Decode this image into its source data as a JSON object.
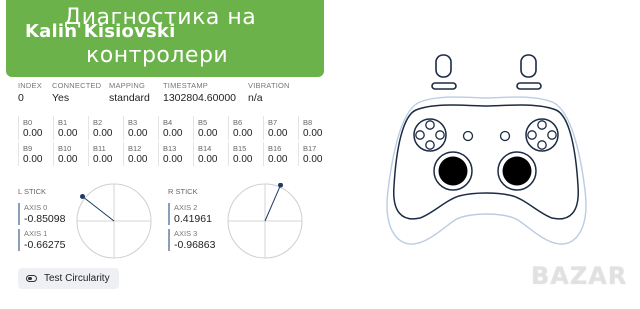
{
  "banner": {
    "author": "Kalin Kisiovski",
    "title_line1": "Диагностика на",
    "title_line2": "контролери"
  },
  "info": [
    {
      "label": "INDEX",
      "value": "0"
    },
    {
      "label": "CONNECTED",
      "value": "Yes"
    },
    {
      "label": "MAPPING",
      "value": "standard"
    },
    {
      "label": "TIMESTAMP",
      "value": "1302804.60000"
    },
    {
      "label": "VIBRATION",
      "value": "n/a"
    }
  ],
  "buttons": [
    {
      "name": "B0",
      "value": "0.00"
    },
    {
      "name": "B1",
      "value": "0.00"
    },
    {
      "name": "B2",
      "value": "0.00"
    },
    {
      "name": "B3",
      "value": "0.00"
    },
    {
      "name": "B4",
      "value": "0.00"
    },
    {
      "name": "B5",
      "value": "0.00"
    },
    {
      "name": "B6",
      "value": "0.00"
    },
    {
      "name": "B7",
      "value": "0.00"
    },
    {
      "name": "B8",
      "value": "0.00"
    },
    {
      "name": "B9",
      "value": "0.00"
    },
    {
      "name": "B10",
      "value": "0.00"
    },
    {
      "name": "B11",
      "value": "0.00"
    },
    {
      "name": "B12",
      "value": "0.00"
    },
    {
      "name": "B13",
      "value": "0.00"
    },
    {
      "name": "B14",
      "value": "0.00"
    },
    {
      "name": "B15",
      "value": "0.00"
    },
    {
      "name": "B16",
      "value": "0.00"
    },
    {
      "name": "B17",
      "value": "0.00"
    }
  ],
  "left_stick": {
    "label": "L STICK",
    "axes": [
      {
        "name": "AXIS 0",
        "value": "-0.85098",
        "numeric": -0.85098
      },
      {
        "name": "AXIS 1",
        "value": "-0.66275",
        "numeric": -0.66275
      }
    ]
  },
  "right_stick": {
    "label": "R STICK",
    "axes": [
      {
        "name": "AXIS 2",
        "value": "0.41961",
        "numeric": 0.41961
      },
      {
        "name": "AXIS 3",
        "value": "-0.96863",
        "numeric": -0.96863
      }
    ]
  },
  "circularity_button": {
    "label": "Test Circularity",
    "icon": "toggle-icon"
  },
  "watermark": "BAZAR",
  "colors": {
    "banner": "#6cb24a",
    "stick_dot": "#1e3a66",
    "controller_outline": "#b9cde3"
  }
}
